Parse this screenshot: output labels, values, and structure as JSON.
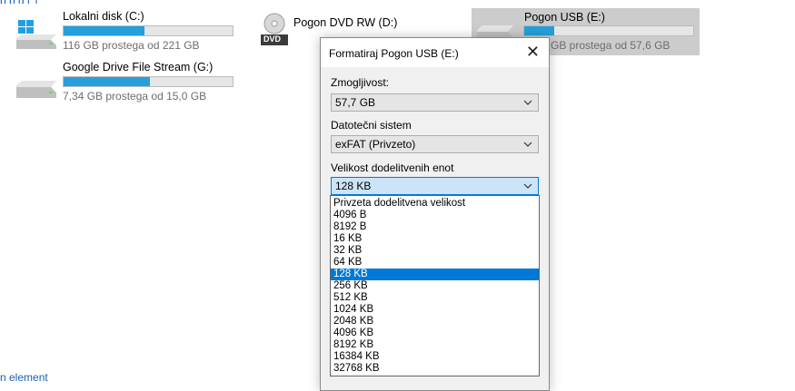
{
  "drives": [
    {
      "name": "Lokalni disk (C:)",
      "free_text": "116 GB prostega od 221 GB",
      "used_fraction": 0.48,
      "icon": "windows-drive-icon"
    },
    {
      "name": "Google Drive File Stream (G:)",
      "free_text": "7,34 GB prostega od 15,0 GB",
      "used_fraction": 0.51,
      "icon": "hard-drive-icon"
    },
    {
      "name": "Pogon DVD RW (D:)",
      "icon": "dvd-drive-icon",
      "icon_text": "DVD"
    },
    {
      "name": "Pogon USB (E:)",
      "free_text": "GB prostega od 57,6 GB",
      "used_fraction": 0.18,
      "icon": "usb-drive-icon"
    }
  ],
  "bottom_fragment": "n element",
  "dialog": {
    "title": "Formatiraj Pogon USB (E:)",
    "capacity_label": "Zmogljivost:",
    "capacity_value": "57,7 GB",
    "filesystem_label": "Datotečni sistem",
    "filesystem_value": "exFAT (Privzeto)",
    "alloc_label": "Velikost dodelitvenih enot",
    "alloc_value": "128 KB"
  },
  "alloc_options": [
    "Privzeta dodelitvena velikost",
    "4096 B",
    "8192 B",
    "16 KB",
    "32 KB",
    "64 KB",
    "128 KB",
    "256 KB",
    "512 KB",
    "1024 KB",
    "2048 KB",
    "4096 KB",
    "8192 KB",
    "16384 KB",
    "32768 KB"
  ],
  "selected_option_index": 6,
  "colors": {
    "accent": "#0078d7",
    "bar_fill": "#26a0da",
    "selected_tile": "#cccccc"
  }
}
